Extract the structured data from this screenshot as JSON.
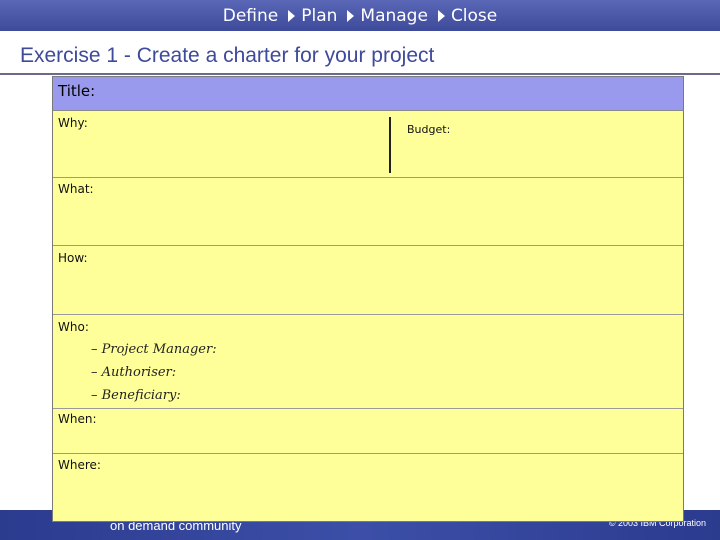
{
  "breadcrumb": {
    "items": [
      "Define",
      "Plan",
      "Manage",
      "Close"
    ]
  },
  "page_title": "Exercise 1 - Create a charter for your project",
  "form": {
    "title_label": "Title:",
    "why_label": "Why:",
    "budget_label": "Budget:",
    "what_label": "What:",
    "how_label": "How:",
    "who_label": "Who:",
    "who_items": [
      "– Project Manager:",
      "– Authoriser:",
      "– Beneficiary:"
    ],
    "when_label": "When:",
    "where_label": "Where:"
  },
  "footer": {
    "left_text": "on demand community",
    "right_text": "© 2003 IBM Corporation"
  },
  "colors": {
    "header_bar": "#3e4a9a",
    "form_fill": "#ffff99",
    "title_row_fill": "#9999ee",
    "footer_bar": "#2b3b8e"
  }
}
